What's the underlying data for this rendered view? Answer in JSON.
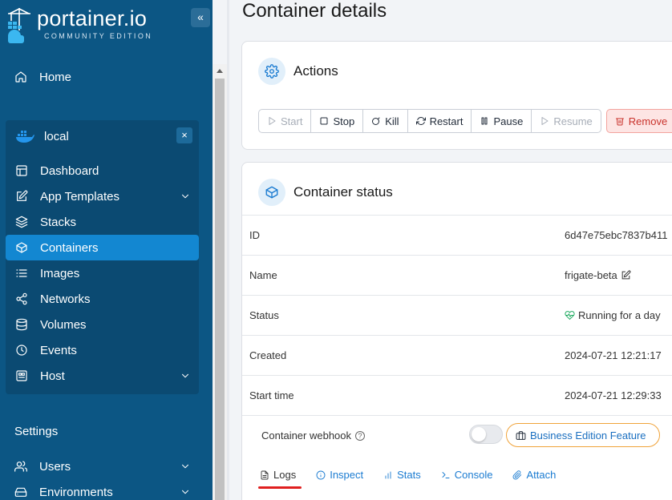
{
  "sidebar": {
    "brand": "portainer.io",
    "edition": "COMMUNITY EDITION",
    "collapse": "«",
    "home": "Home",
    "environment": {
      "name": "local",
      "close": "×",
      "items": [
        {
          "label": "Dashboard",
          "icon": "dashboard-icon"
        },
        {
          "label": "App Templates",
          "icon": "edit-icon"
        },
        {
          "label": "Stacks",
          "icon": "layers-icon"
        },
        {
          "label": "Containers",
          "icon": "box-icon",
          "active": true
        },
        {
          "label": "Images",
          "icon": "list-icon"
        },
        {
          "label": "Networks",
          "icon": "share-icon"
        },
        {
          "label": "Volumes",
          "icon": "database-icon"
        },
        {
          "label": "Events",
          "icon": "clock-icon"
        },
        {
          "label": "Host",
          "icon": "host-icon"
        }
      ]
    },
    "settings_title": "Settings",
    "settings_items": [
      {
        "label": "Users",
        "icon": "users-icon"
      },
      {
        "label": "Environments",
        "icon": "hdd-icon"
      }
    ]
  },
  "main": {
    "title": "Container details",
    "actions": {
      "title": "Actions",
      "buttons": {
        "start": "Start",
        "stop": "Stop",
        "kill": "Kill",
        "restart": "Restart",
        "pause": "Pause",
        "resume": "Resume",
        "remove": "Remove"
      }
    },
    "status": {
      "title": "Container status",
      "rows": [
        {
          "label": "ID",
          "value": "6d47e75ebc7837b411"
        },
        {
          "label": "Name",
          "value": "frigate-beta"
        },
        {
          "label": "Status",
          "value": "Running for a day"
        },
        {
          "label": "Created",
          "value": "2024-07-21 12:21:17"
        },
        {
          "label": "Start time",
          "value": "2024-07-21 12:29:33"
        }
      ],
      "webhook_label": "Container webhook",
      "be_feature": "Business Edition Feature"
    },
    "tabs": [
      "Logs",
      "Inspect",
      "Stats",
      "Console",
      "Attach"
    ]
  },
  "colors": {
    "sidebar_bg": "#0c5684",
    "active_item": "#1387d1",
    "accent": "#1a7bd1",
    "remove": "#c9322b",
    "underline": "#e01f1f"
  }
}
